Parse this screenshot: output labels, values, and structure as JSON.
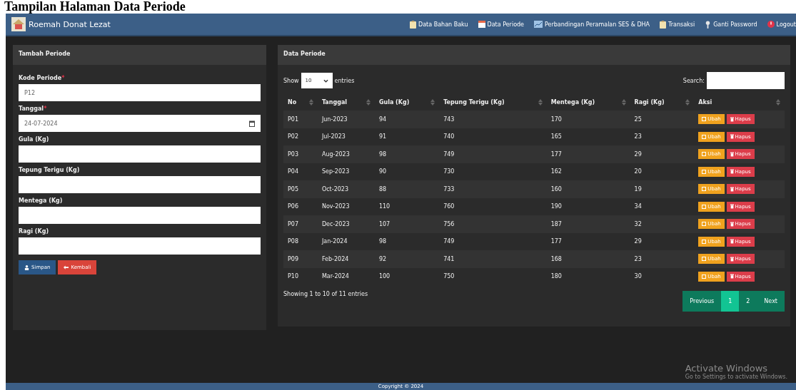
{
  "caption": "Tampilan Halaman Data Periode",
  "navbar": {
    "brand": "Roemah Donat Lezat",
    "items": [
      "Data Bahan Baku",
      "Data Periode",
      "Perbandingan Peramalan SES & DHA",
      "Transaksi",
      "Ganti Password",
      "Logout"
    ]
  },
  "form": {
    "title": "Tambah Periode",
    "fields": [
      {
        "label": "Kode Periode",
        "required_mark": "*",
        "value": "P12",
        "kind": "text"
      },
      {
        "label": "Tanggal",
        "required_mark": "*",
        "value": "24-07-2024",
        "kind": "date"
      },
      {
        "label": "Gula (Kg)",
        "kind": "text"
      },
      {
        "label": "Tepung Terigu (Kg)",
        "kind": "text"
      },
      {
        "label": "Mentega (Kg)",
        "kind": "text"
      },
      {
        "label": "Ragi (Kg)",
        "kind": "text"
      }
    ],
    "buttons": [
      {
        "label": "Simpan",
        "kind": "primary"
      },
      {
        "label": "Kembali",
        "kind": "danger"
      }
    ]
  },
  "table_panel": {
    "title": "Data Periode",
    "show_label": "Show",
    "page_size": "10",
    "entries_label": "entries",
    "search_label": "Search:",
    "columns": [
      "No",
      "Tanggal",
      "Gula (Kg)",
      "Tepung Terigu (Kg)",
      "Mentega (Kg)",
      "Ragi (Kg)",
      "Aksi"
    ],
    "rows": [
      {
        "cells": [
          "P01",
          "Jun-2023",
          "94",
          "743",
          "170",
          "25"
        ],
        "actions": [
          "Ubah",
          "Hapus"
        ]
      },
      {
        "cells": [
          "P02",
          "Jul-2023",
          "91",
          "740",
          "165",
          "23"
        ],
        "actions": [
          "Ubah",
          "Hapus"
        ]
      },
      {
        "cells": [
          "P03",
          "Aug-2023",
          "98",
          "749",
          "177",
          "29"
        ],
        "actions": [
          "Ubah",
          "Hapus"
        ]
      },
      {
        "cells": [
          "P04",
          "Sep-2023",
          "90",
          "730",
          "162",
          "20"
        ],
        "actions": [
          "Ubah",
          "Hapus"
        ]
      },
      {
        "cells": [
          "P05",
          "Oct-2023",
          "88",
          "733",
          "160",
          "19"
        ],
        "actions": [
          "Ubah",
          "Hapus"
        ]
      },
      {
        "cells": [
          "P06",
          "Nov-2023",
          "110",
          "760",
          "190",
          "34"
        ],
        "actions": [
          "Ubah",
          "Hapus"
        ]
      },
      {
        "cells": [
          "P07",
          "Dec-2023",
          "107",
          "756",
          "187",
          "32"
        ],
        "actions": [
          "Ubah",
          "Hapus"
        ]
      },
      {
        "cells": [
          "P08",
          "Jan-2024",
          "98",
          "749",
          "177",
          "29"
        ],
        "actions": [
          "Ubah",
          "Hapus"
        ]
      },
      {
        "cells": [
          "P09",
          "Feb-2024",
          "92",
          "741",
          "168",
          "23"
        ],
        "actions": [
          "Ubah",
          "Hapus"
        ]
      },
      {
        "cells": [
          "P10",
          "Mar-2024",
          "100",
          "750",
          "180",
          "30"
        ],
        "actions": [
          "Ubah",
          "Hapus"
        ]
      }
    ],
    "info": "Showing 1 to 10 of 11 entries",
    "pagination": [
      {
        "label": "Previous",
        "selected": false
      },
      {
        "label": "1",
        "selected": true
      },
      {
        "label": "2",
        "selected": false
      },
      {
        "label": "Next",
        "selected": false
      }
    ]
  },
  "os_notice": {
    "title": "Activate Windows",
    "text": "Go to Settings to activate Windows."
  },
  "footer": "Copyright © 2024"
}
